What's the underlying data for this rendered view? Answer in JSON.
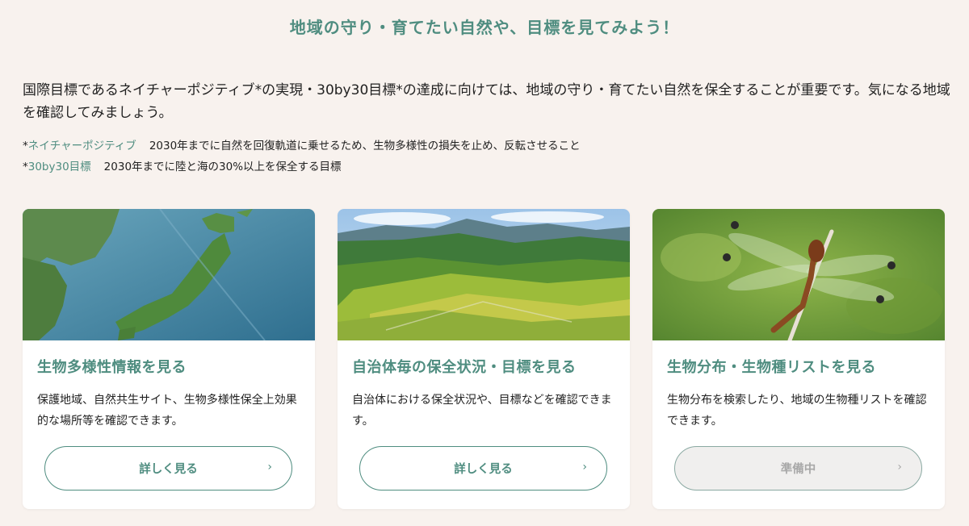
{
  "heading": "地域の守り・育てたい自然や、目標を見てみよう！",
  "intro": "国際目標であるネイチャーポジティブ*の実現・30by30目標*の達成に向けては、地域の守り・育てたい自然を保全することが重要です。気になる地域を確認してみましょう。",
  "notes": [
    {
      "term": "ネイチャーポジティブ",
      "text": "2030年までに自然を回復軌道に乗せるため、生物多様性の損失を止め、反転させること"
    },
    {
      "term": "30by30目標",
      "text": "2030年までに陸と海の30%以上を保全する目標"
    }
  ],
  "note_marker": "*",
  "cards": [
    {
      "image": "japan-relief-map",
      "title": "生物多様性情報を見る",
      "description": "保護地域、自然共生サイト、生物多様性保全上効果的な場所等を確認できます。",
      "button": "詳しく見る",
      "chevron": "›"
    },
    {
      "image": "terraced-fields-landscape",
      "title": "自治体毎の保全状況・目標を見る",
      "description": "自治体における保全状況や、目標などを確認できます。",
      "button": "詳しく見る",
      "chevron": "›"
    },
    {
      "image": "dragonfly-photo",
      "title": "生物分布・生物種リストを見る",
      "description": "生物分布を検索したり、地域の生物種リストを確認できます。",
      "button": "準備中",
      "chevron": "›"
    }
  ],
  "colors": {
    "accent": "#4f8d80",
    "background": "#f8f2ee"
  }
}
